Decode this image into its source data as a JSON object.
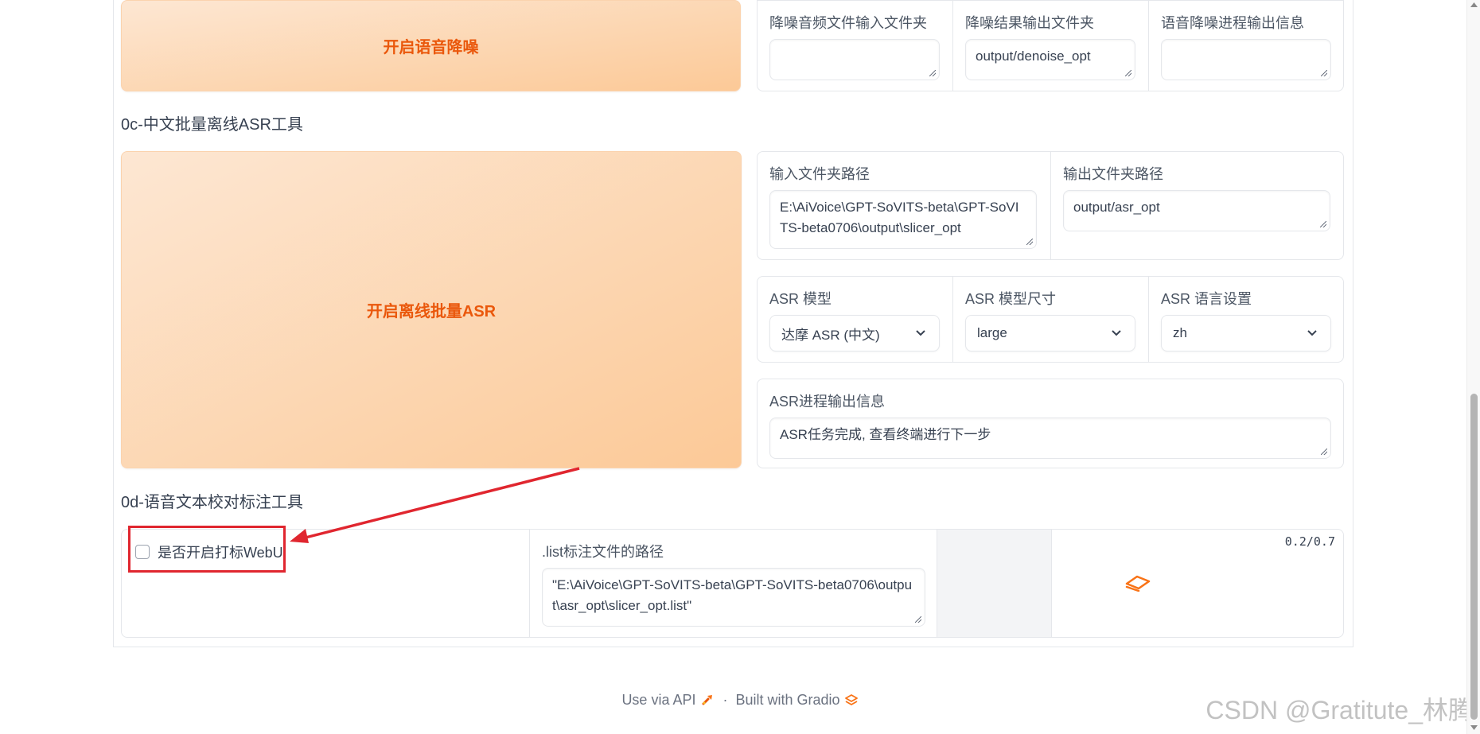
{
  "denoise": {
    "button_label": "开启语音降噪",
    "input_dir": {
      "label": "降噪音频文件输入文件夹",
      "value": ""
    },
    "output_dir": {
      "label": "降噪结果输出文件夹",
      "value": "output/denoise_opt"
    },
    "progress": {
      "label": "语音降噪进程输出信息",
      "value": ""
    }
  },
  "asr": {
    "section_title": "0c-中文批量离线ASR工具",
    "button_label": "开启离线批量ASR",
    "input_dir": {
      "label": "输入文件夹路径",
      "value": "E:\\AiVoice\\GPT-SoVITS-beta\\GPT-SoVITS-beta0706\\output\\slicer_opt"
    },
    "output_dir": {
      "label": "输出文件夹路径",
      "value": "output/asr_opt"
    },
    "model": {
      "label": "ASR 模型",
      "value": "达摩 ASR (中文)"
    },
    "model_size": {
      "label": "ASR 模型尺寸",
      "value": "large"
    },
    "language": {
      "label": "ASR 语言设置",
      "value": "zh"
    },
    "progress": {
      "label": "ASR进程输出信息",
      "value": "ASR任务完成, 查看终端进行下一步"
    }
  },
  "proofread": {
    "section_title": "0d-语音文本校对标注工具",
    "checkbox_label": "是否开启打标WebUI",
    "checkbox_checked": false,
    "list_path": {
      "label": ".list标注文件的路径",
      "value": "\"E:\\AiVoice\\GPT-SoVITS-beta\\GPT-SoVITS-beta0706\\output\\asr_opt\\slicer_opt.list\""
    },
    "timer": "0.2/0.7"
  },
  "footer": {
    "api_link": "Use via API",
    "separator": "·",
    "built_with": "Built with Gradio"
  },
  "watermark": "CSDN @Gratitute_林腾",
  "colors": {
    "accent": "#ea580c",
    "annotation": "#e0262f",
    "button_gradient_start": "#fde7d3",
    "button_gradient_end": "#fcc997"
  },
  "icons": {
    "api": "rocket-icon",
    "gradio": "gradio-logo-icon",
    "loading": "gradio-loading-icon",
    "select": "chevron-down-icon"
  }
}
